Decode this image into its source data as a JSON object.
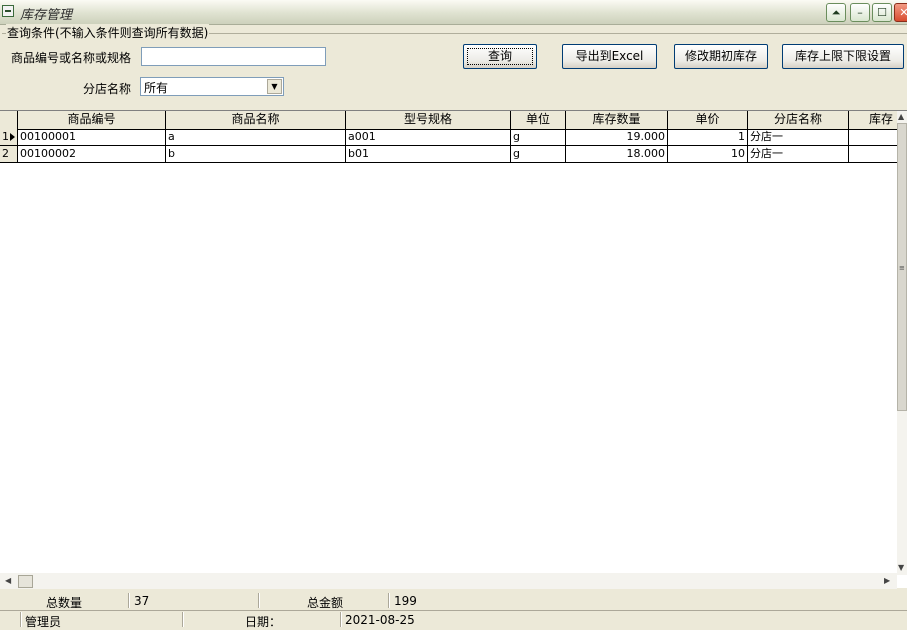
{
  "window": {
    "title": "库存管理",
    "controls": {
      "help": "⏶",
      "minimize": "–",
      "maximize": "☐",
      "close": "✕"
    }
  },
  "query": {
    "group_label": "查询条件(不输入条件则查询所有数据)",
    "product_label": "商品编号或名称或规格",
    "product_value": "",
    "branch_label": "分店名称",
    "branch_value": "所有"
  },
  "buttons": {
    "search": "查询",
    "export": "导出到Excel",
    "edit_opening": "修改期初库存",
    "limit_settings": "库存上限下限设置"
  },
  "grid": {
    "columns": [
      "商品编号",
      "商品名称",
      "型号规格",
      "单位",
      "库存数量",
      "单价",
      "分店名称",
      "库存"
    ],
    "rows": [
      {
        "row_no": "1",
        "cells": [
          "00100001",
          "a",
          "a001",
          "g",
          "19.000",
          "1",
          "分店一",
          ""
        ]
      },
      {
        "row_no": "2",
        "cells": [
          "00100002",
          "b",
          "b01",
          "g",
          "18.000",
          "10",
          "分店一",
          ""
        ]
      }
    ],
    "current_row": 1
  },
  "totals": {
    "qty_label": "总数量",
    "qty_value": "37",
    "amount_label": "总金额",
    "amount_value": "199"
  },
  "status": {
    "user": "管理员",
    "date_label": "日期：",
    "date_value": "2021-08-25"
  }
}
